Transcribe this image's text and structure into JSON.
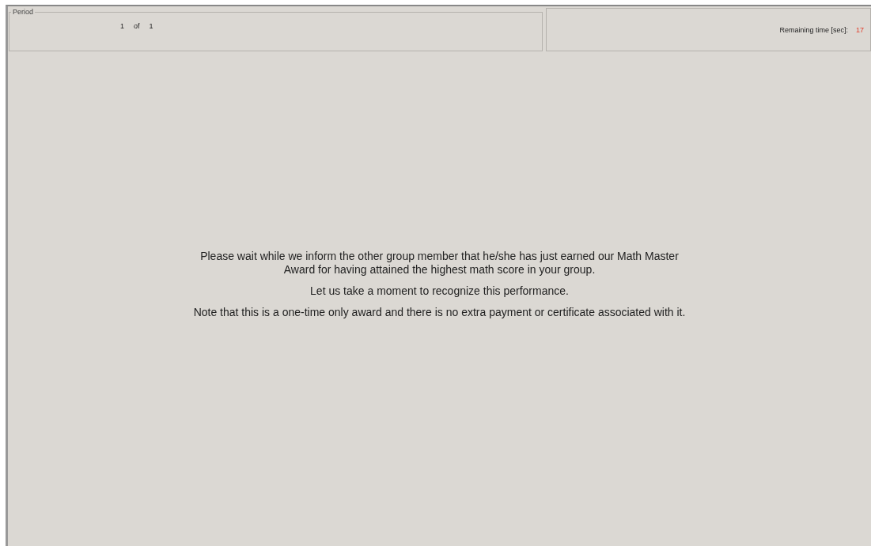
{
  "period": {
    "legend": "Period",
    "current": "1",
    "separator": "of",
    "total": "1"
  },
  "timer": {
    "label": "Remaining time [sec]:",
    "value": "17"
  },
  "message": {
    "paragraphs": [
      "Please wait while we inform the other group member that he/she has just earned our Math Master Award for having attained the highest math score in your group.",
      "Let us take a moment to recognize this performance.",
      "Note that this is a one-time only award and there is no extra payment or certificate associated with it."
    ]
  }
}
